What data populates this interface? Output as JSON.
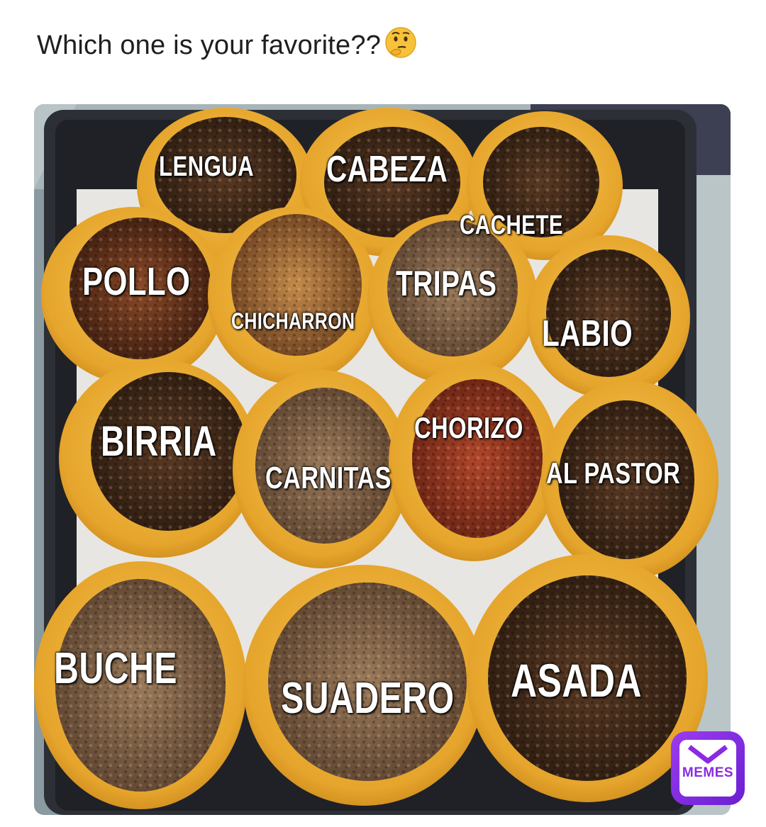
{
  "caption": {
    "text": "Which one is your favorite??",
    "emoji": "thinking-face-emoji"
  },
  "photo": {
    "labels": {
      "lengua": "LENGUA",
      "cabeza": "CABEZA",
      "cachete": "CACHETE",
      "pollo": "POLLO",
      "chicharron": "CHICHARRON",
      "tripas": "TRIPAS",
      "labio": "LABIO",
      "birria": "BIRRIA",
      "carnitas": "CARNITAS",
      "chorizo": "CHORIZO",
      "al_pastor": "AL PASTOR",
      "buche": "BUCHE",
      "suadero": "SUADERO",
      "asada": "ASADA"
    }
  },
  "watermark": {
    "text": "MEMES",
    "brand_color": "#8a2be2"
  }
}
